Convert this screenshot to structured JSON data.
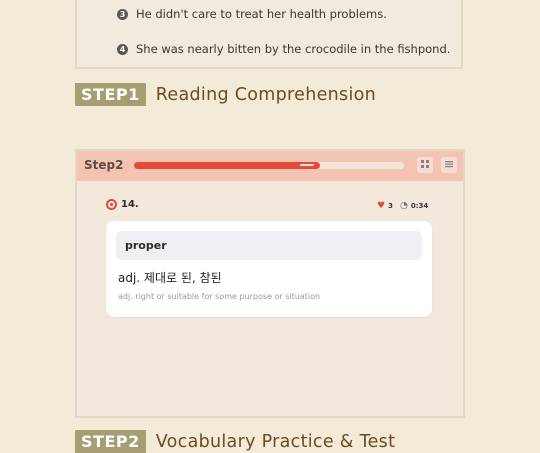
{
  "top_options": [
    {
      "num": "3",
      "text": "He didn't care to treat her health problems."
    },
    {
      "num": "4",
      "text": "She was nearly bitten by the crocodile in the fishpond."
    }
  ],
  "step1": {
    "badge": "STEP1",
    "title": "Reading Comprehension"
  },
  "quiz": {
    "header_label": "Step2",
    "progress": 0.69,
    "question_number": "14.",
    "hearts": "3",
    "timer": "0:34",
    "word": "proper",
    "meaning": "adj. 제대로 된, 참된",
    "definition": "adj. right or suitable for some purpose or situation",
    "icons": {
      "grid": "grid-icon",
      "list": "list-icon",
      "heart": "heart-icon",
      "timer": "timer-icon"
    },
    "accent": "#e54a3b"
  },
  "step2": {
    "badge": "STEP2",
    "title": "Vocabulary Practice & Test"
  }
}
